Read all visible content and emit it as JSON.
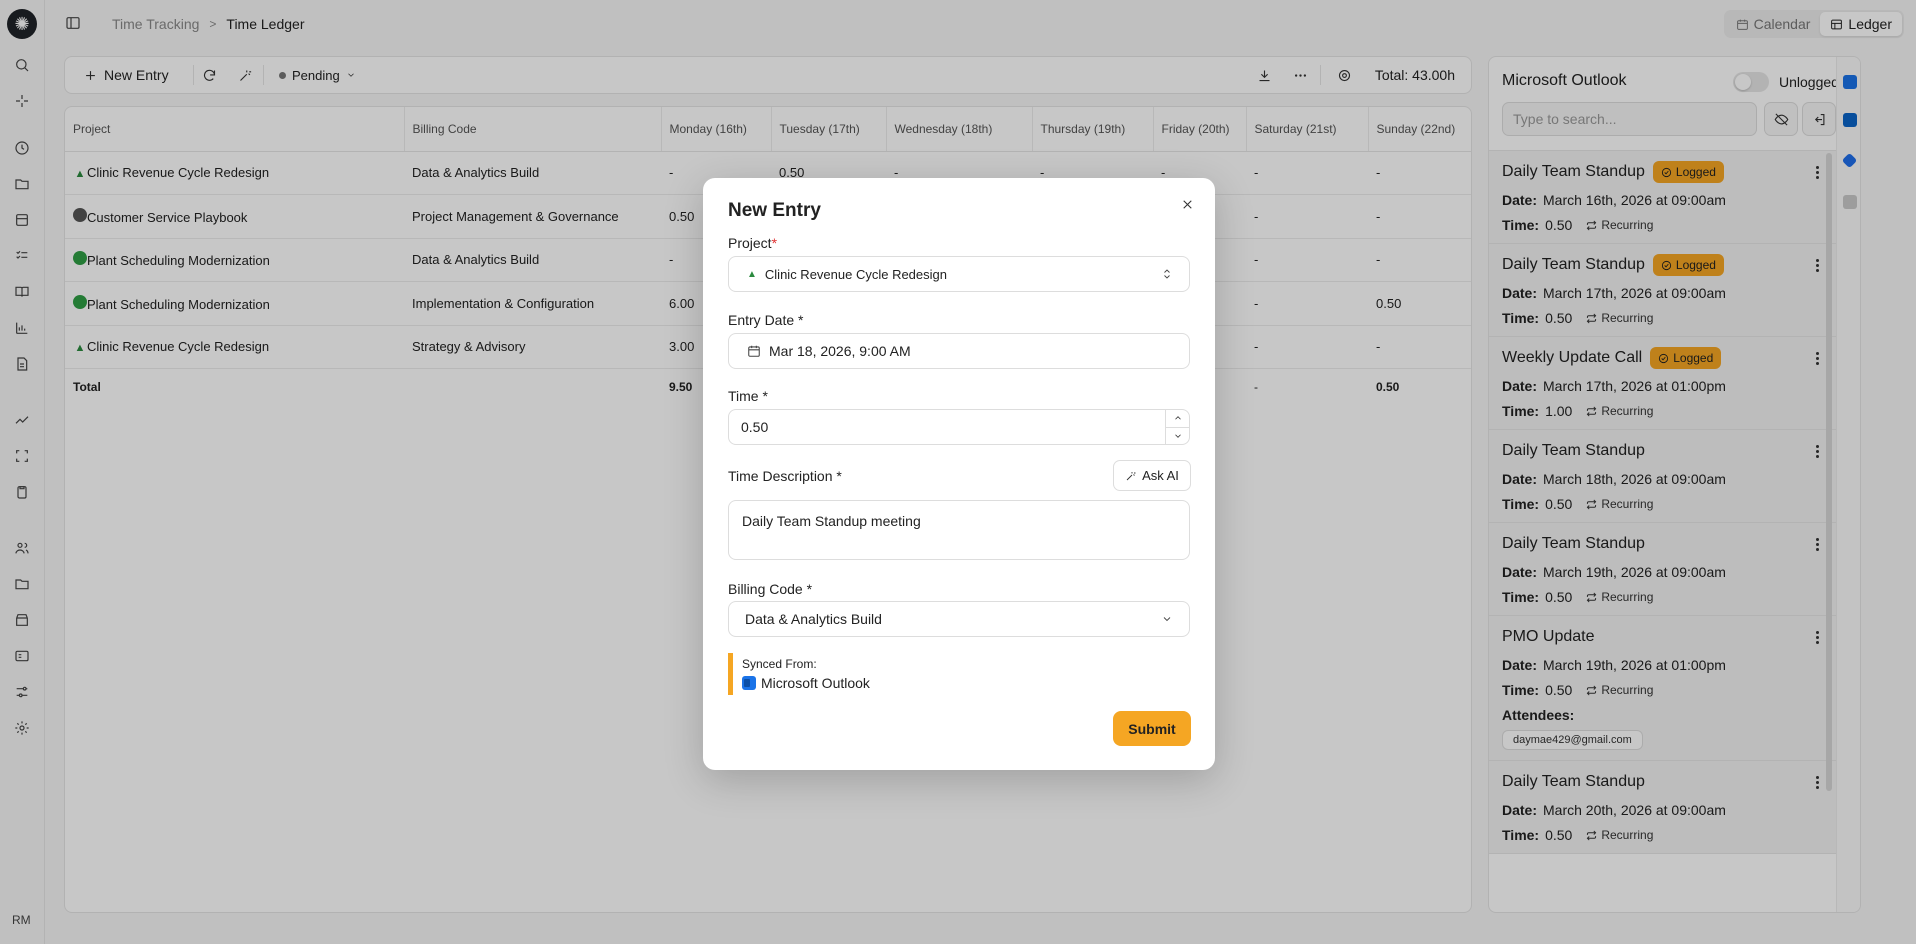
{
  "breadcrumb": {
    "parent": "Time Tracking",
    "current": "Time Ledger"
  },
  "view_toggle": {
    "calendar": "Calendar",
    "ledger": "Ledger",
    "active": "ledger"
  },
  "toolbar": {
    "new_entry": "New Entry",
    "filter_status": "Pending",
    "total": "Total: 43.00h"
  },
  "table": {
    "headers": [
      "Project",
      "Billing Code",
      "Monday (16th)",
      "Tuesday (17th)",
      "Wednesday (18th)",
      "Thursday (19th)",
      "Friday (20th)",
      "Saturday (21st)",
      "Sunday (22nd)"
    ],
    "rows": [
      {
        "project": "Clinic Revenue Cycle Redesign",
        "icon": "tree-icon",
        "billing": "Data & Analytics Build",
        "mon": "-",
        "tue": "0.50",
        "wed": "-",
        "thu": "-",
        "fri": "-",
        "sat": "-",
        "sun": "-"
      },
      {
        "project": "Customer Service Playbook",
        "icon": "dark-circle-icon",
        "billing": "Project Management & Governance",
        "mon": "0.50",
        "tue": "",
        "wed": "",
        "thu": "",
        "fri": "",
        "sat": "-",
        "sun": "-"
      },
      {
        "project": "Plant Scheduling Modernization",
        "icon": "green-circle-icon",
        "billing": "Data & Analytics Build",
        "mon": "-",
        "tue": "",
        "wed": "",
        "thu": "",
        "fri": "",
        "sat": "-",
        "sun": "-"
      },
      {
        "project": "Plant Scheduling Modernization",
        "icon": "green-circle-icon",
        "billing": "Implementation & Configuration",
        "mon": "6.00",
        "tue": "",
        "wed": "",
        "thu": "",
        "fri": "",
        "sat": "-",
        "sun": "0.50"
      },
      {
        "project": "Clinic Revenue Cycle Redesign",
        "icon": "tree-icon",
        "billing": "Strategy & Advisory",
        "mon": "3.00",
        "tue": "",
        "wed": "",
        "thu": "",
        "fri": "",
        "sat": "-",
        "sun": "-"
      }
    ],
    "total": {
      "label": "Total",
      "mon": "9.50",
      "sat": "-",
      "sun": "0.50"
    }
  },
  "outlook_panel": {
    "title": "Microsoft Outlook",
    "toggle_label": "Unlogged",
    "search_placeholder": "Type to search...",
    "events": [
      {
        "title": "Daily Team Standup",
        "logged": "Logged",
        "date_label": "Date:",
        "date": "March 16th, 2026 at 09:00am",
        "time_label": "Time:",
        "time": "0.50",
        "recurring": "Recurring"
      },
      {
        "title": "Daily Team Standup",
        "logged": "Logged",
        "date_label": "Date:",
        "date": "March 17th, 2026 at 09:00am",
        "time_label": "Time:",
        "time": "0.50",
        "recurring": "Recurring"
      },
      {
        "title": "Weekly Update Call",
        "logged": "Logged",
        "date_label": "Date:",
        "date": "March 17th, 2026 at 01:00pm",
        "time_label": "Time:",
        "time": "1.00",
        "recurring": "Recurring"
      },
      {
        "title": "Daily Team Standup",
        "logged": "",
        "date_label": "Date:",
        "date": "March 18th, 2026 at 09:00am",
        "time_label": "Time:",
        "time": "0.50",
        "recurring": "Recurring"
      },
      {
        "title": "Daily Team Standup",
        "logged": "",
        "date_label": "Date:",
        "date": "March 19th, 2026 at 09:00am",
        "time_label": "Time:",
        "time": "0.50",
        "recurring": "Recurring"
      },
      {
        "title": "PMO Update",
        "logged": "",
        "date_label": "Date:",
        "date": "March 19th, 2026 at 01:00pm",
        "time_label": "Time:",
        "time": "0.50",
        "recurring": "Recurring",
        "attendees_label": "Attendees:",
        "attendee": "daymae429@gmail.com"
      },
      {
        "title": "Daily Team Standup",
        "logged": "",
        "date_label": "Date:",
        "date": "March 20th, 2026 at 09:00am",
        "time_label": "Time:",
        "time": "0.50",
        "recurring": "Recurring"
      }
    ]
  },
  "modal": {
    "title": "New Entry",
    "project_label": "Project",
    "project_value": "Clinic Revenue Cycle Redesign",
    "date_label": "Entry Date *",
    "date_value": "Mar 18, 2026, 9:00 AM",
    "time_label": "Time *",
    "time_value": "0.50",
    "desc_label": "Time Description *",
    "ask_ai": "Ask AI",
    "desc_value": "Daily Team Standup meeting",
    "billing_label": "Billing Code *",
    "billing_value": "Data & Analytics Build",
    "synced_label": "Synced From:",
    "synced_value": "Microsoft Outlook",
    "submit": "Submit"
  },
  "user": {
    "initials": "RM"
  },
  "colors": {
    "accent": "#f5a623",
    "required": "#e03131"
  }
}
